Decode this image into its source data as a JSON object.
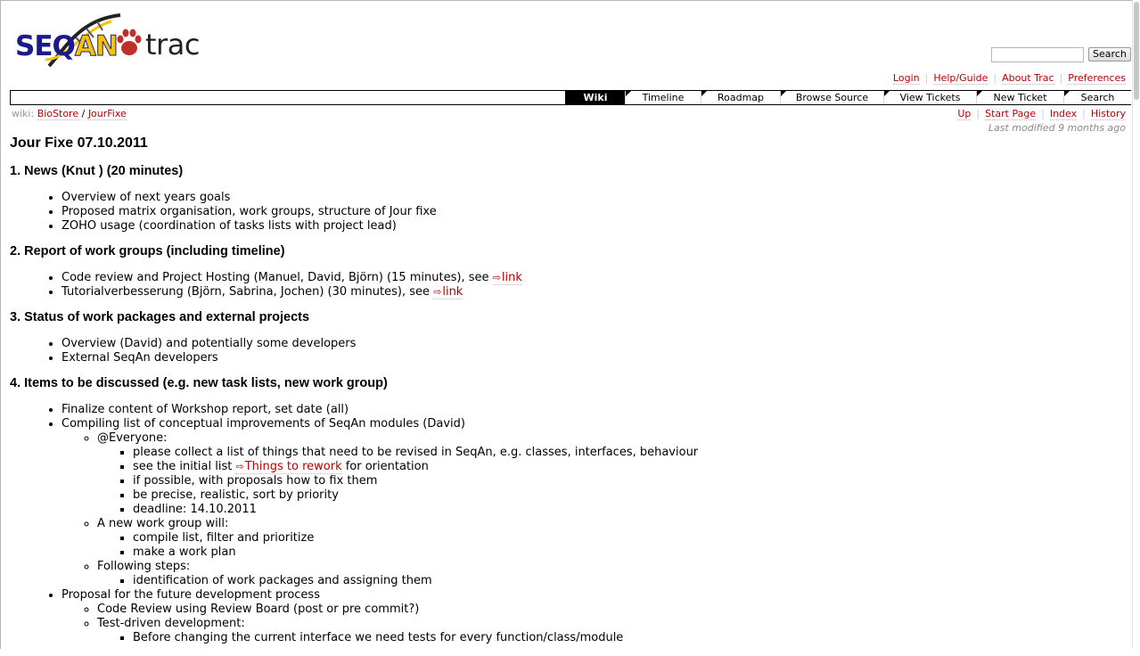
{
  "logo": {
    "seqan_part1": "SEQ",
    "seqan_part2": "AN",
    "trac": "trac"
  },
  "search": {
    "placeholder": "",
    "button_label": "Search"
  },
  "metanav": [
    "Login",
    "Help/Guide",
    "About Trac",
    "Preferences"
  ],
  "mainnav": {
    "tabs": [
      "Wiki",
      "Timeline",
      "Roadmap",
      "Browse Source",
      "View Tickets",
      "New Ticket",
      "Search"
    ],
    "active": "Wiki"
  },
  "breadcrumb": {
    "prefix": "wiki:",
    "parent": "BioStore",
    "separator": "/",
    "current": "JourFixe"
  },
  "ctxnav": [
    "Up",
    "Start Page",
    "Index",
    "History"
  ],
  "last_modified": "Last modified 9 months ago",
  "page": {
    "title": "Jour Fixe 07.10.2011",
    "s1": {
      "heading": "1. News (Knut ) (20 minutes)",
      "items": [
        "Overview of next years goals",
        "Proposed matrix organisation, work groups, structure of Jour fixe",
        "ZOHO usage (coordination of tasks lists with project lead)"
      ]
    },
    "s2": {
      "heading": "2. Report of work groups (including timeline)",
      "item1": "Code review and Project Hosting (Manuel, David, Björn) (15 minutes), see ",
      "item1_link": "link",
      "item2": "Tutorialverbesserung (Björn, Sabrina, Jochen) (30 minutes), see ",
      "item2_link": "link"
    },
    "s3": {
      "heading": "3. Status of work packages and external projects",
      "items": [
        "Overview (David) and potentially some developers",
        "External SeqAn developers"
      ]
    },
    "s4": {
      "heading": "4. Items to be discussed (e.g. new task lists, new work group)",
      "finalize": "Finalize content of Workshop report, set date (all)",
      "compiling": "Compiling list of conceptual improvements of SeqAn modules (David)",
      "everyone": "@Everyone:",
      "everyone_items": {
        "a": "please collect a list of things that need to be revised in SeqAn, e.g. classes, interfaces, behaviour",
        "b_pre": "see the initial list ",
        "b_link": "Things to rework",
        "b_post": " for orientation",
        "c": "if possible, with proposals how to fix them",
        "d": "be precise, realistic, sort by priority",
        "e": "deadline: 14.10.2011"
      },
      "newgroup": "A new work group will:",
      "newgroup_items": [
        "compile list, filter and prioritize",
        "make a work plan"
      ],
      "following": "Following steps:",
      "following_items": [
        "identification of work packages and assigning them"
      ],
      "proposal": "Proposal for the future development process",
      "proposal_items": [
        "Code Review using Review Board (post or pre commit?)",
        "Test-driven development:"
      ],
      "tdd_items": [
        "Before changing the current interface we need tests for every function/class/module"
      ]
    }
  },
  "colors": {
    "link": "#bb0000",
    "nav_active_bg": "#000000"
  },
  "icons": [
    "external-link-icon",
    "paw-icon",
    "helix-icon"
  ]
}
